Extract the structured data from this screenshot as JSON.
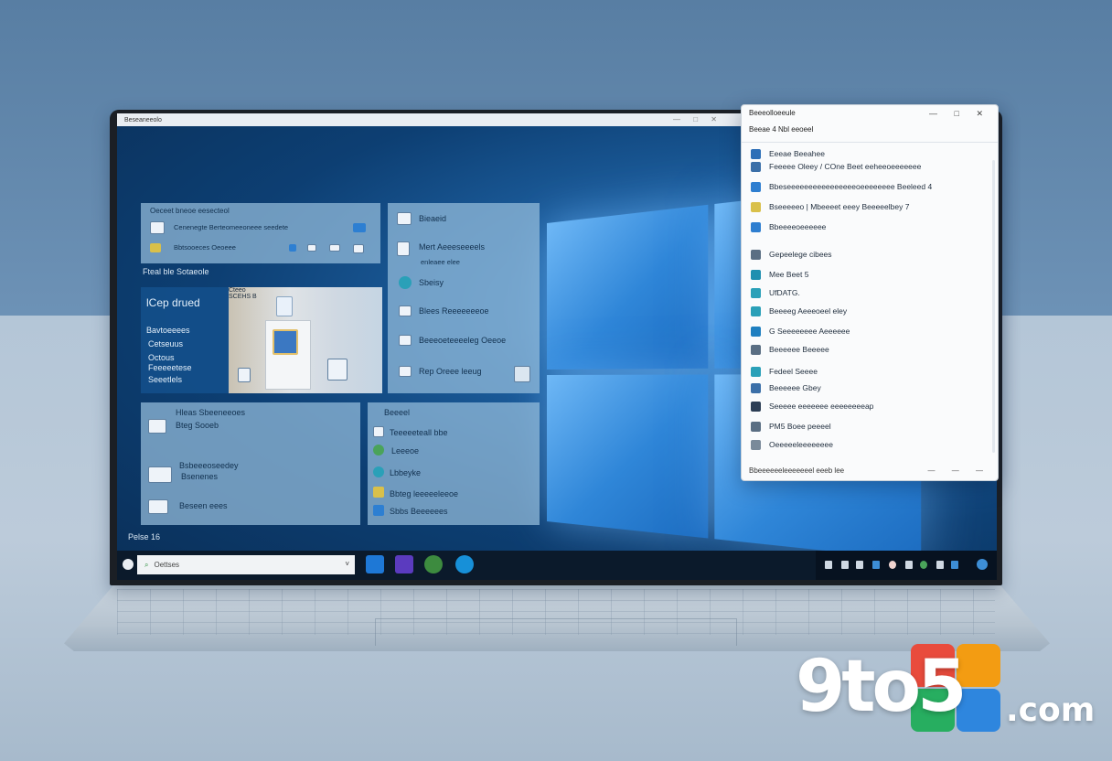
{
  "screen": {
    "window_title": "Beseaneeolo",
    "taskbar": {
      "pin_label": "Pelse 16",
      "search_text": "Oettses",
      "search_chevron": "˅"
    }
  },
  "tiles": {
    "top_left": {
      "title": "Oeceet bneoe eesecteol",
      "line1": "Cenenegte Berteomeeoneee seedete",
      "line2": "Bbtsooeces  Oeoeee"
    },
    "section_label": "Fteal ble Sotaeole",
    "blue_tile": {
      "title": "lCep drued",
      "lines": [
        "Bavtoeeees",
        "Cetseuus",
        "Octous",
        "Feeeeetese",
        "Seeetlels"
      ]
    },
    "photo_caption": [
      "Cteeo",
      "SCEHS B"
    ],
    "right_list": [
      "Bieaeid",
      "Mert Aeeeseeeels",
      "enleaee elee",
      "Sbeisy",
      "Blees Reeeeeeeoe",
      "Beeeoeteeeeleg Oeeoe",
      "Rep Oreee leeug"
    ],
    "bottom_left": {
      "title": "Hleas Sbeeneeoes",
      "items": [
        "Bteg Sooeb",
        "Bsbeeeoseedey",
        "Bsenenes",
        "Beseen eees"
      ]
    },
    "bottom_right": {
      "title": "Beeeel",
      "items": [
        "Teeeeeteall bbe",
        "Leeeoe",
        "Lbbeyke",
        "Bbteg leeeeeleeoe",
        "Sbbs Beeeeees"
      ]
    }
  },
  "flyout": {
    "header": "Beeeolloeeule",
    "controls": "— □ ✕",
    "sub": "Beeae  4    Nbl eeoeel",
    "items": [
      {
        "label": "Eeeae Beeahee",
        "color": "#2d6fb7"
      },
      {
        "label": "Feeeee Oleey / COne Beet eeheeoeeeeeee",
        "color": "#3b6fa8"
      },
      {
        "label": "Bbeseeeeeeeeeeeeeeeeoeeeeeeee  Beeleed 4",
        "color": "#2e7ed0"
      },
      {
        "label": "Bseeeeeo | Mbeeeet eeey Beeeeelbey 7",
        "color": "#d9c04a"
      },
      {
        "label": "Bbeeeeoeeeeee",
        "color": "#2e7ed0"
      },
      {
        "label": "Gepeelege cibees",
        "color": "#5a6e83"
      },
      {
        "label": "Mee Beet 5",
        "color": "#1f8fb0"
      },
      {
        "label": "UfDATG.",
        "color": "#2aa0b8"
      },
      {
        "label": "Beeeeg Aeeeoeel eley",
        "color": "#2aa0b8"
      },
      {
        "label": "G Seeeeeeee Aeeeeee",
        "color": "#1f7fc0"
      },
      {
        "label": "Beeeeee Beeeee",
        "color": "#5a6e83"
      },
      {
        "label": "Fedeel Seeee",
        "color": "#2aa0b8"
      },
      {
        "label": "Beeeeee Gbey",
        "color": "#3b6fa8"
      },
      {
        "label": "Seeeee eeeeeee eeeeeeeeap",
        "color": "#2c3e55"
      },
      {
        "label": "PM5 Boee peeeel",
        "color": "#5a6e83"
      },
      {
        "label": "Oeeeeeleeeeeeee",
        "color": "#7a8a9a"
      }
    ],
    "footer": "Bbeeeeeeleeeeeeel eeeb lee",
    "footer_controls": "— — —"
  },
  "watermark": {
    "text": "9to5",
    "suffix": ".com",
    "colors": [
      "#e94b3c",
      "#f39c12",
      "#27ae60",
      "#2e86de"
    ]
  },
  "colors": {
    "desktop_blue": "#1d5f9f",
    "tile_blue": "#96bedc",
    "taskbar": "#0b1a2b"
  }
}
